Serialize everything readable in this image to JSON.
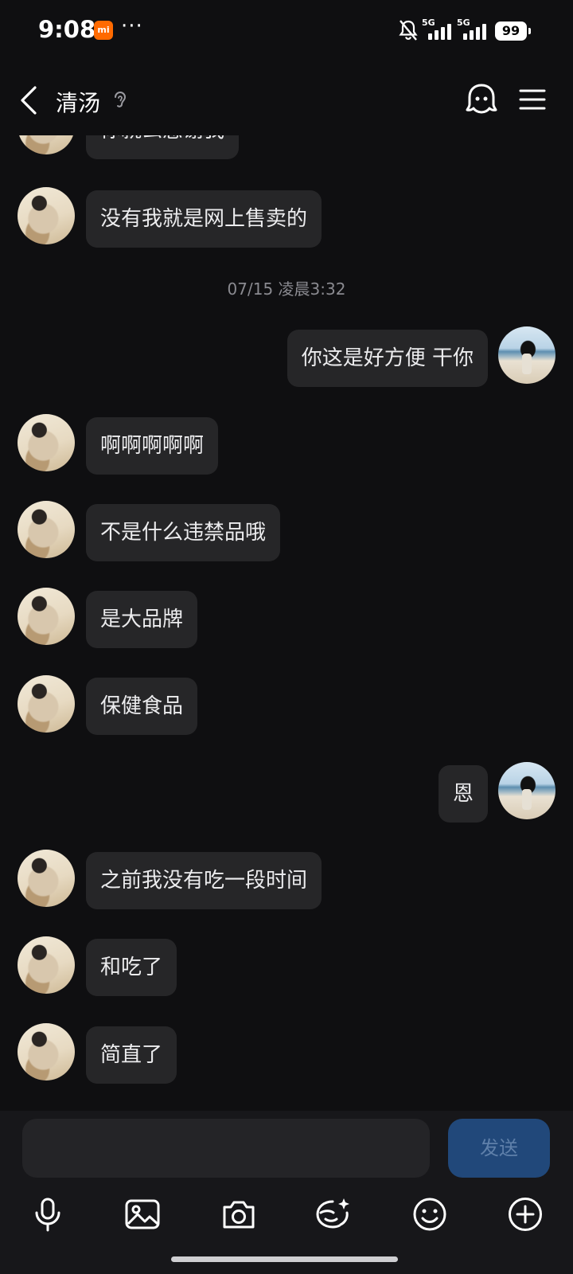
{
  "status_bar": {
    "time": "9:08",
    "mi_label": "mi",
    "dots": "···",
    "network_1": "5G",
    "network_2": "5G",
    "battery": "99"
  },
  "header": {
    "contact_name": "清汤"
  },
  "chat": {
    "partial_message": "你就么感谢我",
    "timestamp": "07/15 凌晨3:32",
    "messages": [
      {
        "from": "other",
        "text": "没有我就是网上售卖的"
      },
      {
        "from": "self",
        "text": "你这是好方便 干你"
      },
      {
        "from": "other",
        "text": "啊啊啊啊啊"
      },
      {
        "from": "other",
        "text": "不是什么违禁品哦"
      },
      {
        "from": "other",
        "text": "是大品牌"
      },
      {
        "from": "other",
        "text": "保健食品"
      },
      {
        "from": "self",
        "text": "恩"
      },
      {
        "from": "other",
        "text": "之前我没有吃一段时间"
      },
      {
        "from": "other",
        "text": "和吃了"
      },
      {
        "from": "other",
        "text": "简直了"
      }
    ]
  },
  "input": {
    "placeholder": "",
    "send_label": "发送"
  },
  "toolbar": {
    "icons": [
      "microphone-icon",
      "image-icon",
      "camera-icon",
      "sticker-icon",
      "emoji-icon",
      "plus-icon"
    ]
  },
  "colors": {
    "background": "#0f0f11",
    "bubble": "#262628",
    "send_button": "#21487a",
    "accent": "#ff6a00"
  }
}
